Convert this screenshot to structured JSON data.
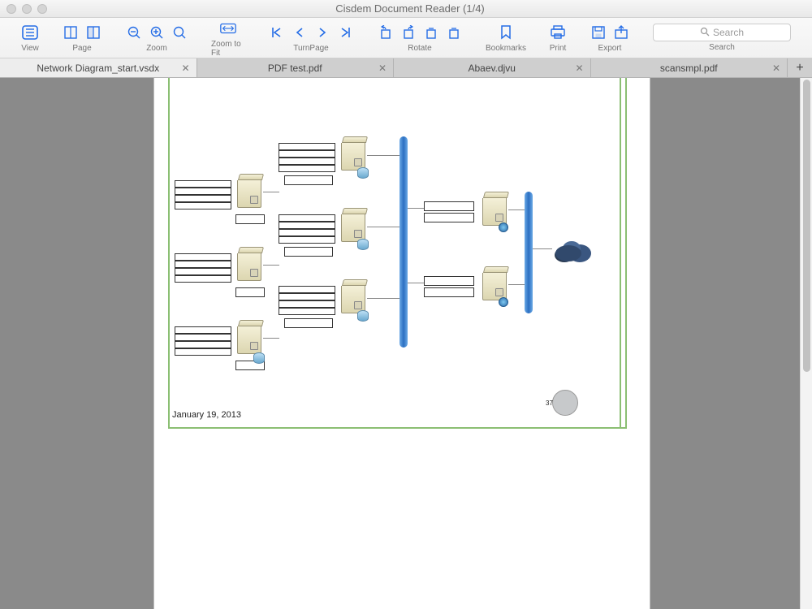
{
  "window": {
    "title": "Cisdem Document Reader (1/4)"
  },
  "toolbar": {
    "view_label": "View",
    "page_label": "Page",
    "zoom_label": "Zoom",
    "zoomfit_label": "Zoom to Fit",
    "turnpage_label": "TurnPage",
    "rotate_label": "Rotate",
    "bookmarks_label": "Bookmarks",
    "print_label": "Print",
    "export_label": "Export",
    "search_placeholder": "Search",
    "search_label": "Search"
  },
  "tabs": [
    {
      "label": "Network Diagram_start.vsdx",
      "active": true
    },
    {
      "label": "PDF test.pdf",
      "active": false
    },
    {
      "label": "Abaev.djvu",
      "active": false
    },
    {
      "label": "scansmpl.pdf",
      "active": false
    }
  ],
  "document": {
    "date": "January 19, 2013",
    "page_number": "37"
  }
}
